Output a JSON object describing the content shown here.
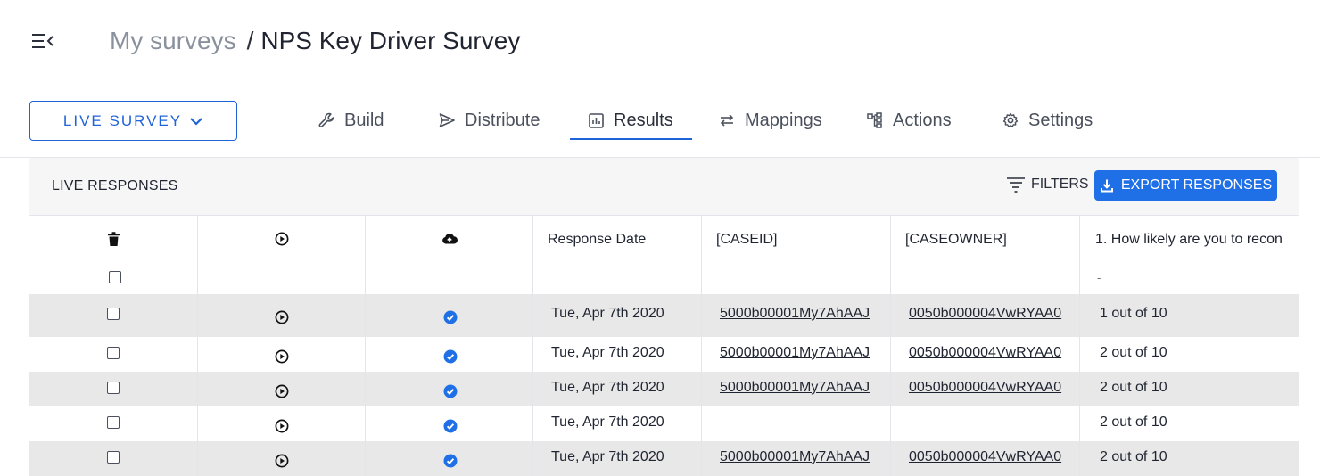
{
  "header": {
    "breadcrumb_parent": "My surveys",
    "breadcrumb_separator": "/",
    "breadcrumb_current": "NPS Key Driver Survey"
  },
  "status_button": {
    "label": "LIVE SURVEY"
  },
  "tabs": [
    {
      "label": "Build",
      "icon": "wrench-icon"
    },
    {
      "label": "Distribute",
      "icon": "send-icon"
    },
    {
      "label": "Results",
      "icon": "bar-chart-icon",
      "active": true
    },
    {
      "label": "Mappings",
      "icon": "swap-arrows-icon"
    },
    {
      "label": "Actions",
      "icon": "workflow-icon"
    },
    {
      "label": "Settings",
      "icon": "gear-icon"
    }
  ],
  "panel": {
    "title": "LIVE RESPONSES",
    "filters_label": "FILTERS",
    "export_label": "EXPORT RESPONSES"
  },
  "table": {
    "columns": [
      {
        "icon": "trash-icon"
      },
      {
        "icon": "play-circle-icon"
      },
      {
        "icon": "cloud-upload-icon"
      },
      {
        "label": "Response Date"
      },
      {
        "label": "[CASEID]"
      },
      {
        "label": "[CASEOWNER]"
      },
      {
        "label": "1. How likely are you to recon",
        "sub": "-"
      }
    ],
    "rows": [
      {
        "date": "Tue, Apr 7th 2020",
        "caseid": "5000b00001My7AhAAJ",
        "owner": "0050b000004VwRYAA0",
        "score": "1 out of 10"
      },
      {
        "date": "Tue, Apr 7th 2020",
        "caseid": "5000b00001My7AhAAJ",
        "owner": "0050b000004VwRYAA0",
        "score": "2 out of 10"
      },
      {
        "date": "Tue, Apr 7th 2020",
        "caseid": "5000b00001My7AhAAJ",
        "owner": "0050b000004VwRYAA0",
        "score": "2 out of 10"
      },
      {
        "date": "Tue, Apr 7th 2020",
        "caseid": "",
        "owner": "",
        "score": "2 out of 10"
      },
      {
        "date": "Tue, Apr 7th 2020",
        "caseid": "5000b00001My7AhAAJ",
        "owner": "0050b000004VwRYAA0",
        "score": "2 out of 10"
      }
    ]
  },
  "colors": {
    "accent": "#1f63d8",
    "export_button": "#1f6fe6",
    "row_stripe": "#e8e8e8",
    "check_badge": "#1f6fe6",
    "breadcrumb_parent": "#8a919e"
  }
}
